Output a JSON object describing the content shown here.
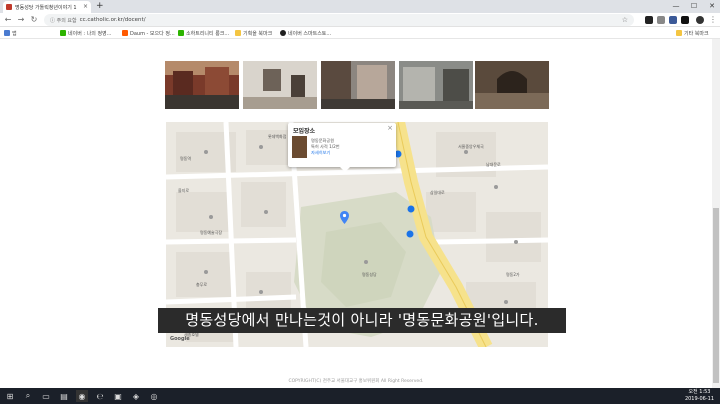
{
  "browser": {
    "tab_title": "명동성당 가톨릭청년이야기 1",
    "tab_close_glyph": "×",
    "new_tab_glyph": "+",
    "window_controls": [
      "—",
      "☐",
      "✕"
    ],
    "security_label": "ⓘ 주의 요함",
    "url": "cc.catholic.or.kr/docent/",
    "star_glyph": "☆",
    "nav_back_glyph": "←",
    "nav_forward_glyph": "→",
    "nav_reload_glyph": "↻",
    "bookmarks": [
      {
        "label": "앱",
        "color": "#4a7bd0"
      },
      {
        "label": "네이버 : 나의 정영...",
        "color": "#2db400"
      },
      {
        "label": "Daum - 모으다 정...",
        "color": "#ff5a00"
      },
      {
        "label": "소하트리니티 롱크...",
        "color": "#2db400"
      },
      {
        "label": "기획을 북마크",
        "color": "#f4c542"
      },
      {
        "label": "네이버 스마트스토...",
        "color": "#1f1f1f"
      }
    ],
    "bookmarks_other": "기타 북마크"
  },
  "page": {
    "top_text": "·   ·   ·   ·   ·",
    "info_window": {
      "title": "모임장소",
      "close_glyph": "×",
      "line1": "명동문화공원",
      "line2": "특허 사적 1/2번",
      "link": "자세히보기"
    },
    "map_labels": [
      "명동역",
      "을지로",
      "명동성당",
      "서울중앙우체국",
      "명동예술극장",
      "충무로",
      "세종호텔",
      "삼일대로",
      "명동2가",
      "남대문로",
      "퇴계로",
      "롯데백화점"
    ],
    "map_attribution": "Google",
    "subtitle": "명동성당에서 만나는것이 아니라 '명동문화공원'입니다.",
    "footer": "COPYRIGHT(C) 천주교 서울대교구 홍보위원회 All Right Reserved."
  },
  "taskbar": {
    "time": "오전 1:53",
    "date": "2019-06-11"
  }
}
